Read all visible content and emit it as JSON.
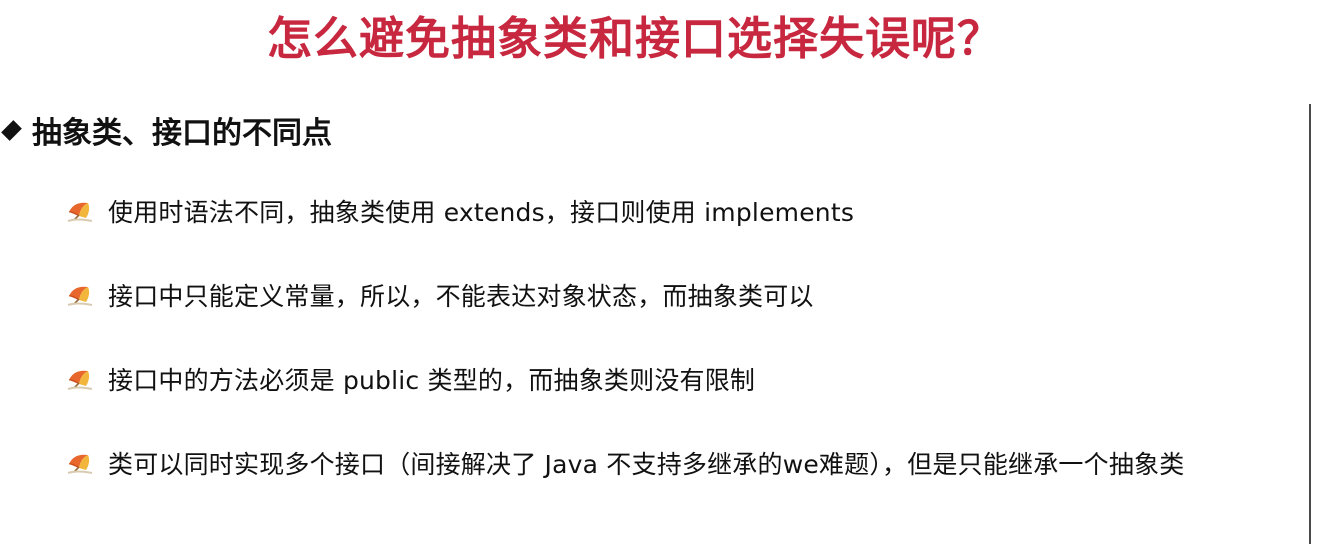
{
  "slide": {
    "title": "怎么避免抽象类和接口选择失误呢？",
    "accent_color": "#c8283f"
  },
  "section": {
    "bullet_icon": "diamond-bullet",
    "heading": "抽象类、接口的不同点",
    "items_icon": "umbrella-icon",
    "items": [
      {
        "text": "使用时语法不同，抽象类使用 extends，接口则使用 implements"
      },
      {
        "text": "接口中只能定义常量，所以，不能表达对象状态，而抽象类可以"
      },
      {
        "text": "接口中的方法必须是 public 类型的，而抽象类则没有限制"
      },
      {
        "text": "类可以同时实现多个接口（间接解决了 Java 不支持多继承的we难题），但是只能继承一个抽象类"
      }
    ]
  }
}
